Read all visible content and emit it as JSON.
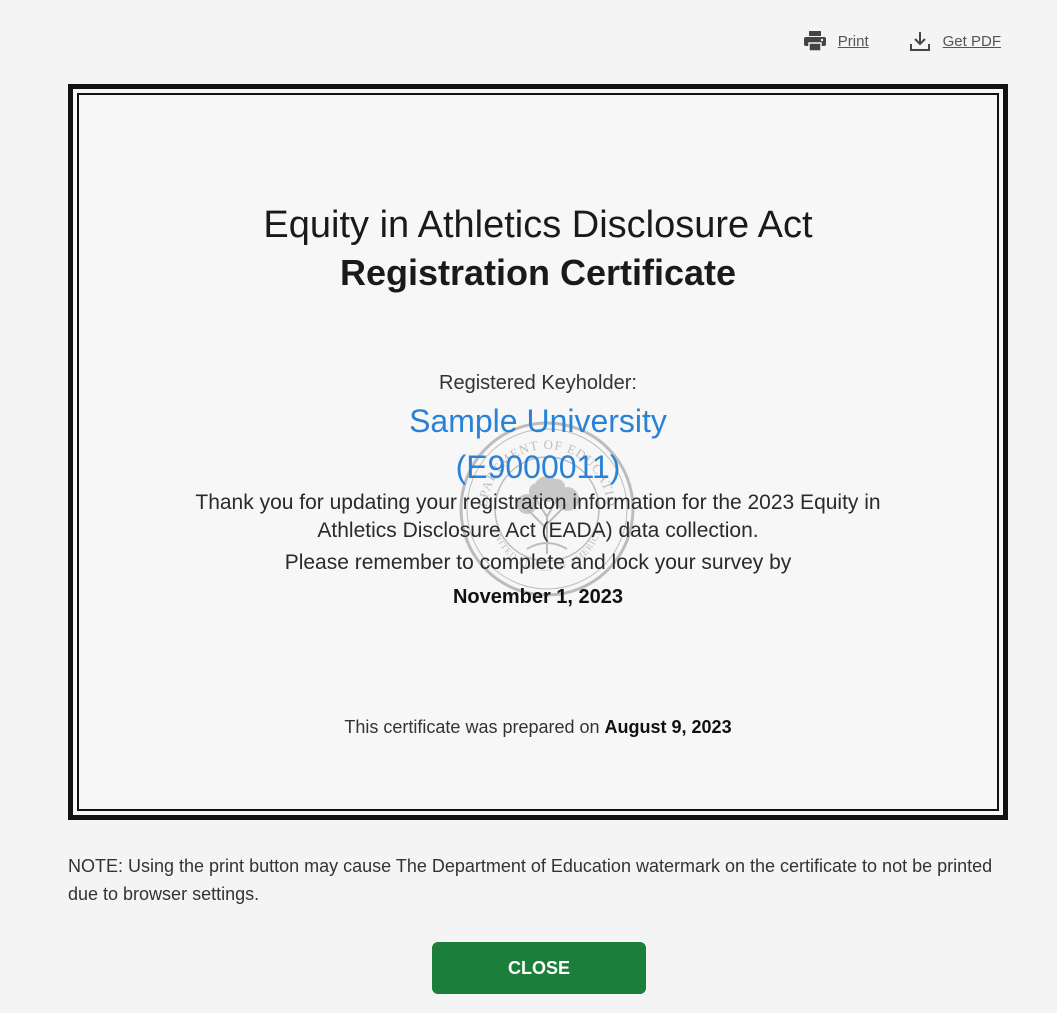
{
  "toolbar": {
    "print_label": "Print",
    "pdf_label": "Get PDF",
    "print_icon": "printer-icon",
    "pdf_icon": "download-icon"
  },
  "certificate": {
    "heading_line1": "Equity in Athletics Disclosure Act",
    "heading_line2": "Registration Certificate",
    "keyholder_label": "Registered Keyholder:",
    "keyholder_name": "Sample University",
    "keyholder_id": "(E9000011)",
    "thanks_text": "Thank you for updating your registration information for the 2023 Equity in Athletics Disclosure Act (EADA) data collection.",
    "reminder_text": "Please remember to complete and lock your survey by",
    "deadline": "November 1, 2023",
    "prepared_prefix": "This certificate was prepared on",
    "prepared_date": "August 9, 2023",
    "watermark_icon": "department-of-education-seal-icon",
    "seal_text_top": "DEPARTMENT OF EDUCATION",
    "seal_text_bottom": "UNITED STATES OF AMERICA"
  },
  "note": "NOTE: Using the print button may cause The Department of Education watermark on the certificate to not be printed due to browser settings.",
  "close_label": "CLOSE",
  "colors": {
    "accent_blue": "#2a82d6",
    "close_green": "#1b7f3a",
    "background": "#f4f4f4"
  }
}
